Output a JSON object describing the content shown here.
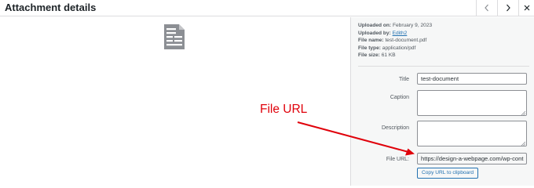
{
  "header": {
    "title": "Attachment details",
    "prev_icon": "chevron-left-icon",
    "next_icon": "chevron-right-icon",
    "close_icon": "close-icon"
  },
  "preview": {
    "icon": "document-icon"
  },
  "details": {
    "uploaded_on_label": "Uploaded on:",
    "uploaded_on_value": " February 9, 2023",
    "uploaded_by_label": "Uploaded by:",
    "uploaded_by_value": "Edith2",
    "file_name_label": "File name:",
    "file_name_value": " test-document.pdf",
    "file_type_label": "File type:",
    "file_type_value": " application/pdf",
    "file_size_label": "File size:",
    "file_size_value": " 61 KB"
  },
  "form": {
    "title_label": "Title",
    "title_value": "test-document",
    "caption_label": "Caption",
    "caption_value": "",
    "description_label": "Description",
    "description_value": "",
    "file_url_label": "File URL:",
    "file_url_value": "https://design-a-webpage.com/wp-cont",
    "copy_button_label": "Copy URL to clipboard"
  },
  "annotation": {
    "text": "File URL",
    "color": "#e0000a"
  },
  "colors": {
    "accent": "#2271b1",
    "border": "#dcdcde",
    "sidebar_bg": "#f6f7f7"
  }
}
